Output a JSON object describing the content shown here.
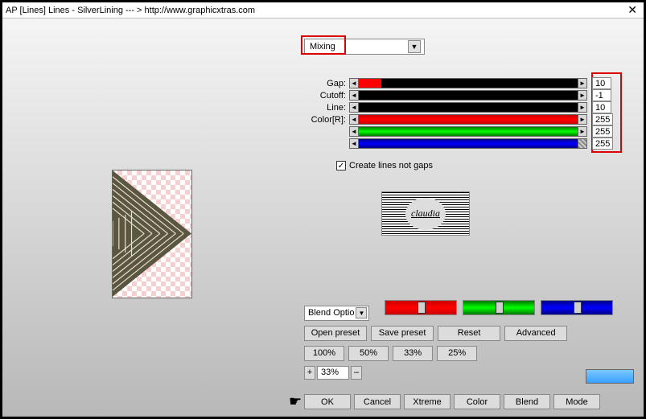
{
  "window": {
    "title": "AP [Lines]  Lines - SilverLining    --- >  http://www.graphicxtras.com"
  },
  "mixing": {
    "selected": "Mixing"
  },
  "sliders": {
    "labels": {
      "gap": "Gap:",
      "cutoff": "Cutoff:",
      "line": "Line:",
      "color": "Color[R]:"
    },
    "values": {
      "gap": "10",
      "cutoff": "-1",
      "line": "10",
      "r": "255",
      "g": "255",
      "b": "255"
    }
  },
  "checkbox": {
    "createLines": "Create lines not gaps",
    "checked": "✓"
  },
  "logo": {
    "text": "claudia"
  },
  "blendOptions": {
    "label": "Blend Optio"
  },
  "buttons": {
    "openPreset": "Open preset",
    "savePreset": "Save preset",
    "reset": "Reset",
    "advanced": "Advanced",
    "p100": "100%",
    "p50": "50%",
    "p33": "33%",
    "p25": "25%",
    "plus": "+",
    "minus": "–",
    "zoom": "33%",
    "ok": "OK",
    "cancel": "Cancel",
    "xtreme": "Xtreme",
    "color": "Color",
    "blend": "Blend",
    "mode": "Mode"
  }
}
